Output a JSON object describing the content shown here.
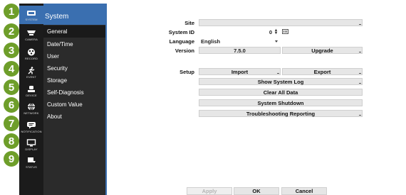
{
  "markers": [
    "1",
    "2",
    "3",
    "4",
    "5",
    "6",
    "7",
    "8",
    "9"
  ],
  "rail": [
    {
      "label": "SYSTEM",
      "icon": "system-icon"
    },
    {
      "label": "CAMERA",
      "icon": "camera-icon"
    },
    {
      "label": "RECORD",
      "icon": "record-icon"
    },
    {
      "label": "EVENT",
      "icon": "event-icon"
    },
    {
      "label": "DEVICE",
      "icon": "device-icon"
    },
    {
      "label": "NETWORK",
      "icon": "network-icon"
    },
    {
      "label": "NOTIFICATION",
      "icon": "notification-icon"
    },
    {
      "label": "DISPLAY",
      "icon": "display-icon"
    },
    {
      "label": "STATUS",
      "icon": "status-icon"
    }
  ],
  "submenu": {
    "title": "System",
    "items": [
      "General",
      "Date/Time",
      "User",
      "Security",
      "Storage",
      "Self-Diagnosis",
      "Custom Value",
      "About"
    ]
  },
  "form": {
    "site_label": "Site",
    "site_value": "",
    "system_id_label": "System ID",
    "system_id_value": "0",
    "language_label": "Language",
    "language_value": "English",
    "version_label": "Version",
    "version_value": "7.5.0",
    "upgrade_label": "Upgrade",
    "setup_label": "Setup",
    "import_label": "Import",
    "export_label": "Export",
    "show_log_label": "Show System Log",
    "clear_label": "Clear All Data",
    "shutdown_label": "System Shutdown",
    "troubleshoot_label": "Troubleshooting Reporting"
  },
  "footer": {
    "apply": "Apply",
    "ok": "OK",
    "cancel": "Cancel"
  },
  "colors": {
    "accent": "#3a6fb0",
    "marker": "#6e9e2a",
    "rail": "#1b1b1b",
    "submenu": "#2b2b2b"
  }
}
